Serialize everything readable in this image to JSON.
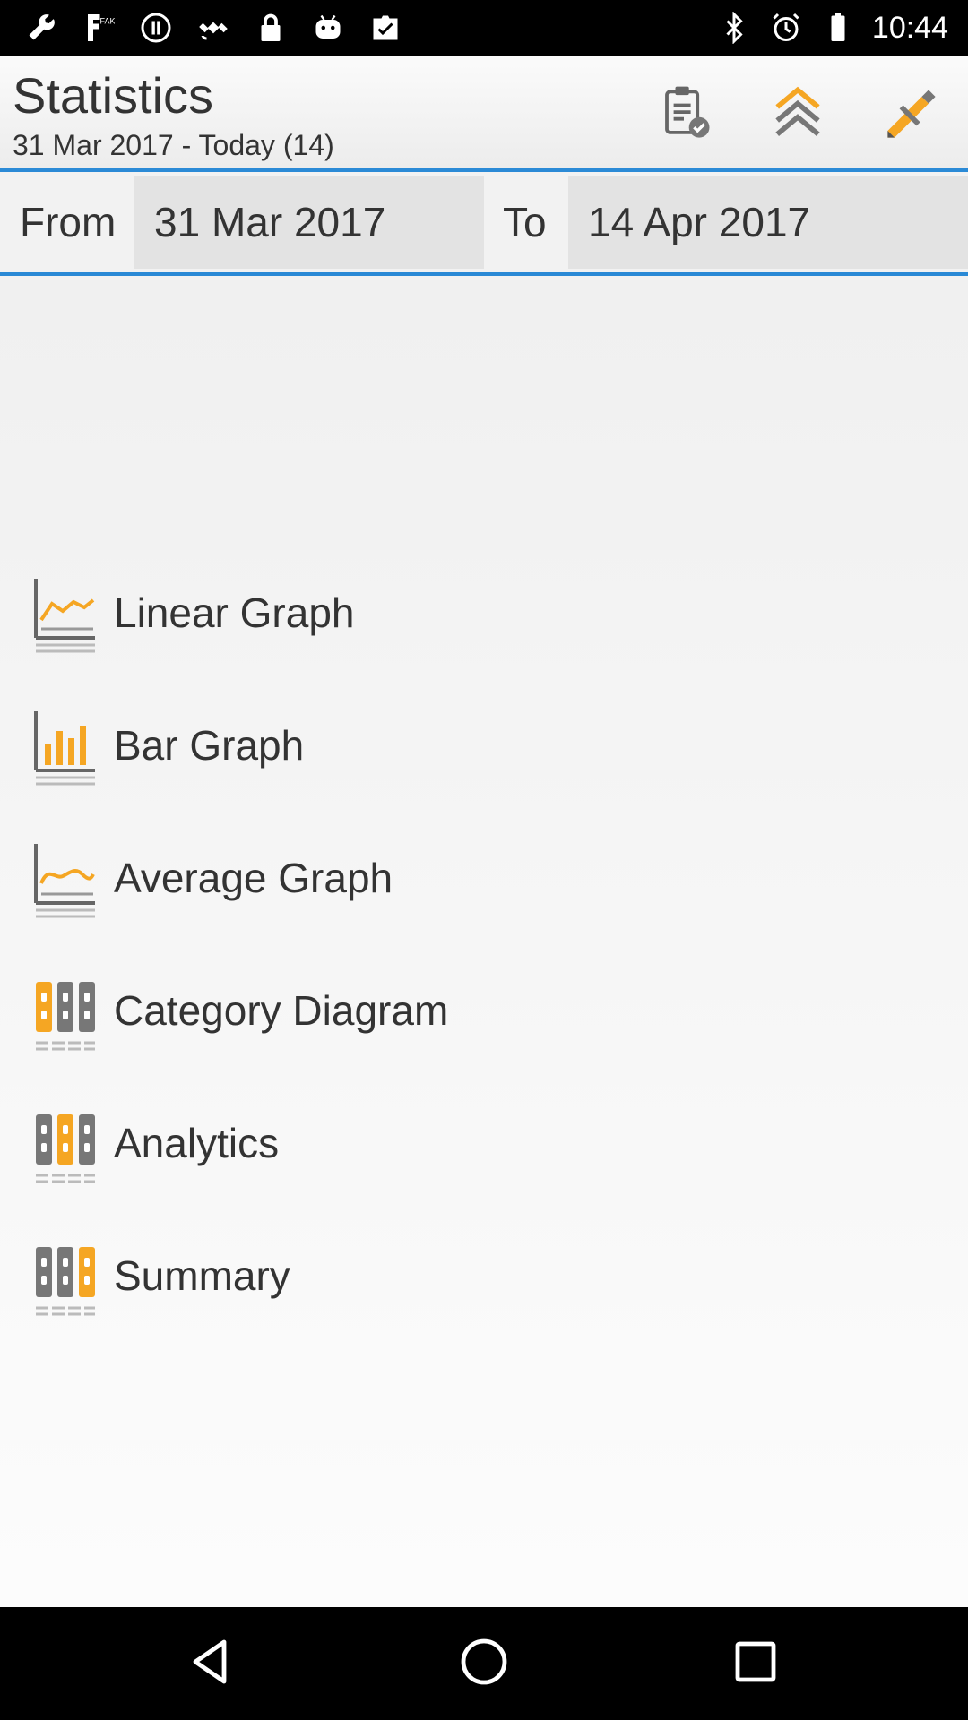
{
  "status_bar": {
    "time": "10:44",
    "left_icons": [
      "wrench-icon",
      "fake-gps-icon",
      "do-not-disturb-icon",
      "satellite-icon",
      "lock-icon",
      "android-icon",
      "clipboard-check-icon"
    ],
    "right_icons": [
      "bluetooth-icon",
      "alarm-icon",
      "battery-icon"
    ]
  },
  "action_bar": {
    "title": "Statistics",
    "subtitle": "31 Mar 2017 - Today (14)",
    "actions": [
      "clipboard-check-icon",
      "chevrons-up-icon",
      "pencil-icon"
    ]
  },
  "date_range": {
    "from_label": "From",
    "from_value": "31 Mar 2017",
    "to_label": "To",
    "to_value": "14 Apr 2017"
  },
  "menu": {
    "items": [
      {
        "label": "Linear Graph",
        "icon": "line-chart-icon"
      },
      {
        "label": "Bar Graph",
        "icon": "bar-chart-icon"
      },
      {
        "label": "Average Graph",
        "icon": "average-chart-icon"
      },
      {
        "label": "Category Diagram",
        "icon": "binders-icon"
      },
      {
        "label": "Analytics",
        "icon": "binders-icon"
      },
      {
        "label": "Summary",
        "icon": "binders-icon"
      }
    ]
  },
  "nav_bar": {
    "buttons": [
      "back-icon",
      "home-icon",
      "recents-icon"
    ]
  },
  "colors": {
    "accent": "#2b8ad6",
    "icon_orange": "#f5a623",
    "icon_gray": "#6f6f6f"
  }
}
